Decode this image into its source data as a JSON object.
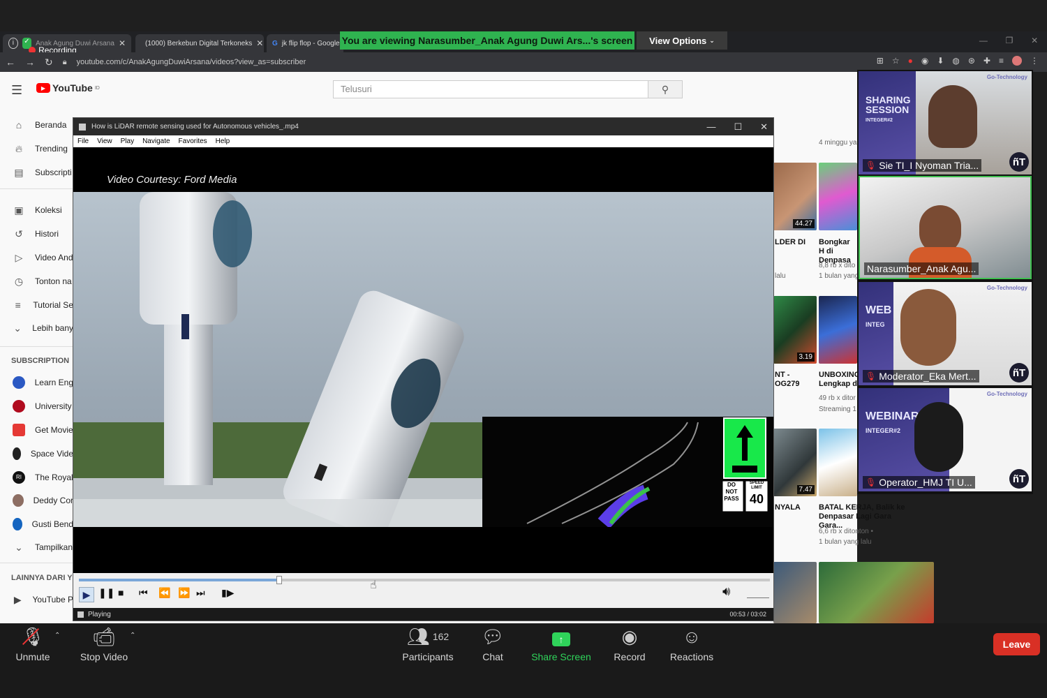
{
  "browser": {
    "tabs": [
      {
        "label": "Anak Agung Duwi Arsana"
      },
      {
        "label": "(1000) Berkebun Digital Terkoneks"
      },
      {
        "label": "jk flip flop - Google"
      }
    ],
    "recording_label": "Recording",
    "url": "youtube.com/c/AnakAgungDuwiArsana/videos?view_as=subscriber"
  },
  "zoom_banner": {
    "message": "You are viewing Narasumber_Anak Agung Duwi Ars...'s screen",
    "view_options": "View Options"
  },
  "youtube": {
    "logo_text": "YouTube",
    "logo_sup": "ID",
    "search_placeholder": "Telusuri",
    "nav": [
      {
        "icon": "home-icon",
        "label": "Beranda"
      },
      {
        "icon": "trending-icon",
        "label": "Trending"
      },
      {
        "icon": "subscriptions-icon",
        "label": "Subscripti"
      },
      {
        "icon": "library-icon",
        "label": "Koleksi"
      },
      {
        "icon": "history-icon",
        "label": "Histori"
      },
      {
        "icon": "your-videos-icon",
        "label": "Video And"
      },
      {
        "icon": "watch-later-icon",
        "label": "Tonton na"
      },
      {
        "icon": "playlist-icon",
        "label": "Tutorial Se"
      },
      {
        "icon": "chevron-down-icon",
        "label": "Lebih bany"
      }
    ],
    "subscription_heading": "SUBSCRIPTION",
    "subscriptions": [
      {
        "label": "Learn Eng",
        "color": "#2b59c3"
      },
      {
        "label": "University",
        "color": "#b00b1e"
      },
      {
        "label": "Get Movie",
        "color": "#e53935"
      },
      {
        "label": "Space Vide",
        "color": "#222222"
      },
      {
        "label": "The Royal",
        "color": "#111111"
      },
      {
        "label": "Deddy Cor",
        "color": "#8d6e63"
      },
      {
        "label": "Gusti Bend",
        "color": "#1565c0"
      },
      {
        "label": "Tampilkan",
        "color": ""
      }
    ],
    "more_heading": "LAINNYA DARI YO",
    "more_items": [
      {
        "label": "YouTube P"
      }
    ],
    "videos": [
      {
        "title": "",
        "meta1": "4 minggu ya",
        "meta2": "",
        "duration": ""
      },
      {
        "title": "LDER DI",
        "meta1": "lalu",
        "meta2": "",
        "duration": "44.27"
      },
      {
        "title": "Bongkar H di Denpasa",
        "meta1": "8,8 rb x dito",
        "meta2": "1 bulan yang",
        "duration": ""
      },
      {
        "title": "NT - OG279",
        "meta1": "",
        "meta2": "",
        "duration": "3.19"
      },
      {
        "title": "UNBOXING Lengkap d",
        "meta1": "49 rb x ditor",
        "meta2": "Streaming 1",
        "duration": ""
      },
      {
        "title": "NYALA",
        "meta1": "",
        "meta2": "",
        "duration": "7.47"
      },
      {
        "title": "BATAL KERJA, Balik ke Denpasar Lagi Gara Gara...",
        "meta1": "6,6 rb x ditonton •",
        "meta2": "1 bulan yang lalu",
        "duration": ""
      }
    ]
  },
  "player": {
    "title": "How is LiDAR remote sensing used for Autonomous vehicles_.mp4",
    "menu": [
      "File",
      "View",
      "Play",
      "Navigate",
      "Favorites",
      "Help"
    ],
    "courtesy": "Video Courtesy: Ford Media",
    "sign_do_not_pass": "DO NOT PASS",
    "sign_speed_limit_label": "SPEED LIMIT",
    "sign_speed_value": "40",
    "status": "Playing",
    "time": "00:53 / 03:02",
    "progress_fraction": 0.29
  },
  "participants": [
    {
      "name": "Sie TI_I Nyoman Tria...",
      "poster": "SHARING SESSION",
      "poster_sub": "INTEGER#2",
      "muted": true,
      "active": false
    },
    {
      "name": "Narasumber_Anak Agu...",
      "poster": "",
      "poster_sub": "",
      "muted": false,
      "active": true
    },
    {
      "name": "Moderator_Eka Mert...",
      "poster": "WEB",
      "poster_sub": "INTEG",
      "muted": true,
      "active": false
    },
    {
      "name": "Operator_HMJ TI U...",
      "poster": "WEBINAR",
      "poster_sub": "INTEGER#2",
      "muted": true,
      "active": false
    }
  ],
  "gallery_brand": "Go-Technology",
  "zoom_toolbar": {
    "unmute": "Unmute",
    "stop_video": "Stop Video",
    "participants": "Participants",
    "participant_count": "162",
    "chat": "Chat",
    "share_screen": "Share Screen",
    "record": "Record",
    "reactions": "Reactions",
    "leave": "Leave"
  },
  "colors": {
    "share_green": "#2fb350",
    "leave_red": "#d93025",
    "yt_red": "#ff0000",
    "active_speaker": "#3fbf4f"
  }
}
